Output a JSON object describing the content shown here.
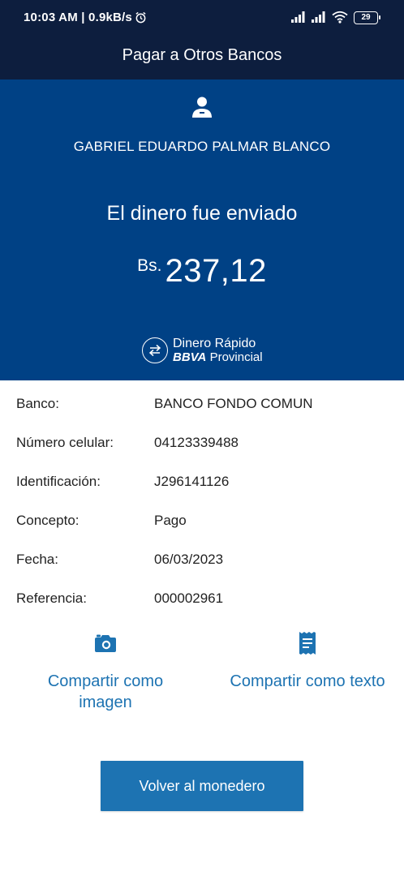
{
  "status_bar": {
    "time": "10:03 AM | 0.9kB/s",
    "battery": "29"
  },
  "app_bar": {
    "title": "Pagar a Otros Bancos"
  },
  "summary": {
    "recipient_name": "GABRIEL EDUARDO PALMAR BLANCO",
    "message": "El dinero fue enviado",
    "currency": "Bs.",
    "amount": "237,12"
  },
  "brand": {
    "line1": "Dinero Rápido",
    "bbva": "BBVA",
    "provincial": "Provincial"
  },
  "details": [
    {
      "label": "Banco:",
      "value": "BANCO FONDO COMUN"
    },
    {
      "label": "Número celular:",
      "value": "04123339488"
    },
    {
      "label": "Identificación:",
      "value": "J296141126"
    },
    {
      "label": "Concepto:",
      "value": "Pago"
    },
    {
      "label": "Fecha:",
      "value": "06/03/2023"
    },
    {
      "label": "Referencia:",
      "value": "000002961"
    }
  ],
  "share": {
    "image_label": "Compartir como imagen",
    "text_label": "Compartir como texto"
  },
  "actions": {
    "return_label": "Volver al monedero"
  },
  "colors": {
    "status_bar_bg": "#0d1e3e",
    "hero_bg": "#004185",
    "accent": "#1d73b2"
  },
  "icons": {
    "alarm": "alarm-clock-icon",
    "signal": "cell-signal-icon",
    "wifi": "wifi-icon",
    "battery": "battery-icon",
    "person": "person-icon",
    "brand": "transfer-arrows-icon",
    "camera": "camera-icon",
    "receipt": "receipt-icon"
  }
}
